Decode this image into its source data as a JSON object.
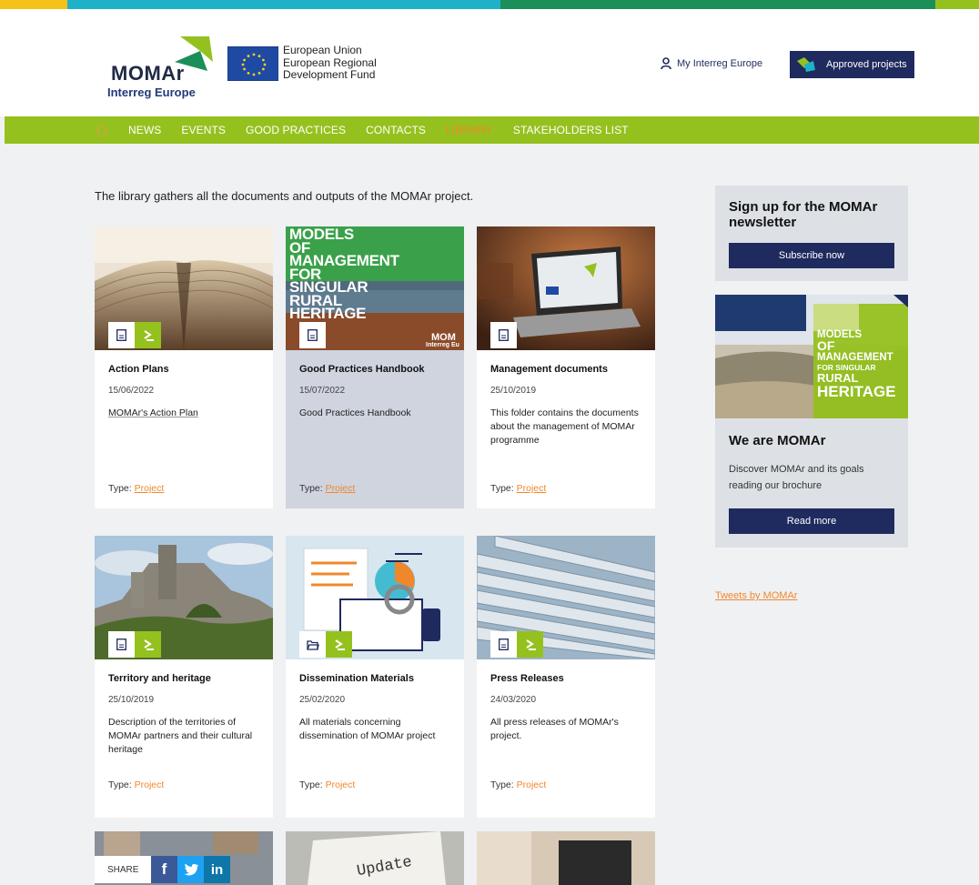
{
  "colors": {
    "bar_yellow": "#f5c21b",
    "bar_teal": "#1eb2c9",
    "bar_green": "#1a8f5a",
    "bar_lime": "#95c11f",
    "nav_green": "#95c11f",
    "navy": "#1f2a5e",
    "accent_orange": "#f0882b"
  },
  "header": {
    "logo_text": "MOMAr",
    "logo_sub": "Interreg Europe",
    "eu_line1": "European Union",
    "eu_line2": "European Regional",
    "eu_line3": "Development Fund",
    "my_interreg": "My Interreg Europe",
    "approved_projects": "Approved projects"
  },
  "nav": {
    "items": [
      {
        "label": "NEWS"
      },
      {
        "label": "EVENTS"
      },
      {
        "label": "GOOD PRACTICES"
      },
      {
        "label": "CONTACTS"
      },
      {
        "label": "LIBRARY"
      },
      {
        "label": "STAKEHOLDERS LIST"
      }
    ],
    "active": "LIBRARY"
  },
  "intro": "The library gathers all the documents and outputs of the MOMAr project.",
  "cards": [
    {
      "title": "Action Plans",
      "date": "15/06/2022",
      "desc": "MOMAr's Action Plan",
      "type_label": "Type:",
      "type_value": "Project",
      "icons": [
        "document-icon",
        "arrow-icon"
      ]
    },
    {
      "title": "Good Practices Handbook",
      "date": "15/07/2022",
      "desc": "Good Practices Handbook",
      "type_label": "Type:",
      "type_value": "Project",
      "icons": [
        "document-icon"
      ],
      "image_text": [
        "MODELS",
        "OF",
        "MANAGEMENT",
        "FOR",
        "SINGULAR",
        "RURAL",
        "HERITAGE"
      ],
      "image_corner": "MOM",
      "image_corner_sub": "Interreg Eu"
    },
    {
      "title": "Management documents",
      "date": "25/10/2019",
      "desc": "This folder contains the documents about the management of MOMAr programme",
      "type_label": "Type:",
      "type_value": "Project",
      "icons": [
        "document-icon"
      ]
    },
    {
      "title": "Territory and heritage",
      "date": "25/10/2019",
      "desc": "Description of the territories of MOMAr partners and their cultural heritage",
      "type_label": "Type:",
      "type_value": "Project",
      "icons": [
        "document-icon",
        "arrow-icon"
      ]
    },
    {
      "title": "Dissemination Materials",
      "date": "25/02/2020",
      "desc": "All materials concerning dissemination of MOMAr project",
      "type_label": "Type:",
      "type_value": "Project",
      "icons": [
        "folder-icon",
        "arrow-icon"
      ]
    },
    {
      "title": "Press Releases",
      "date": "24/03/2020",
      "desc": "All press releases of MOMAr's project.",
      "type_label": "Type:",
      "type_value": "Project",
      "icons": [
        "document-icon",
        "arrow-icon"
      ]
    }
  ],
  "sidebar": {
    "newsletter_title": "Sign up for the MOMAr newsletter",
    "subscribe": "Subscribe now",
    "brochure_image_text": [
      "MODELS",
      "OF",
      "MANAGEMENT",
      "FOR SINGULAR",
      "RURAL",
      "HERITAGE"
    ],
    "about_title": "We are MOMAr",
    "about_text": "Discover MOMAr and its goals reading our brochure",
    "read_more": "Read more",
    "tweets": "Tweets by MOMAr"
  },
  "share": {
    "label": "SHARE",
    "facebook": "f",
    "linkedin": "in"
  },
  "bottom_cards": [
    {
      "image_text": "Update"
    }
  ]
}
